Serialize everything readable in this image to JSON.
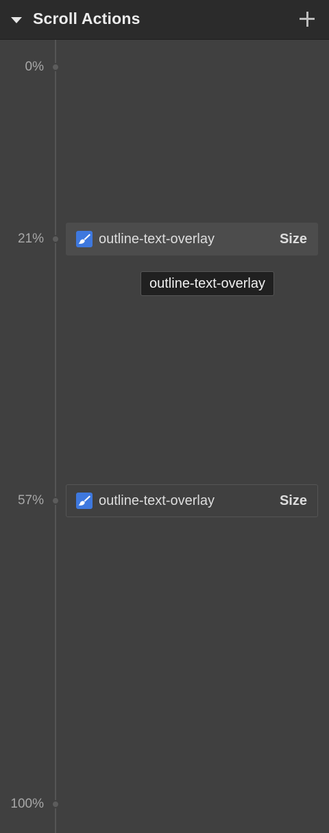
{
  "header": {
    "title": "Scroll Actions",
    "collapse_icon": "caret-down-icon",
    "add_icon": "plus-icon"
  },
  "timeline": {
    "markers": [
      {
        "label": "0%"
      },
      {
        "label": "21%"
      },
      {
        "label": "57%"
      },
      {
        "label": "100%"
      }
    ]
  },
  "actions": [
    {
      "name": "outline-text-overlay",
      "type": "Size",
      "icon": "brush-icon",
      "selected": true
    },
    {
      "name": "outline-text-overlay",
      "type": "Size",
      "icon": "brush-icon",
      "selected": false
    }
  ],
  "tooltip": {
    "text": "outline-text-overlay"
  },
  "colors": {
    "panel_bg": "#404040",
    "header_bg": "#2b2b2b",
    "accent": "#3e78de"
  }
}
